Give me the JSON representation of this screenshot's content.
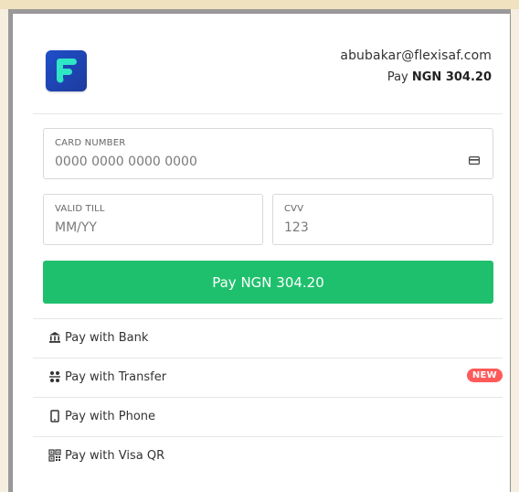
{
  "header": {
    "email": "abubakar@flexisaf.com",
    "pay_prefix": "Pay",
    "pay_amount": "NGN 304.20"
  },
  "card_number": {
    "label": "CARD NUMBER",
    "placeholder": "0000 0000 0000 0000"
  },
  "valid_till": {
    "label": "VALID TILL",
    "placeholder": "MM/YY"
  },
  "cvv": {
    "label": "CVV",
    "placeholder": "123"
  },
  "pay_button": {
    "label": "Pay NGN 304.20"
  },
  "options": [
    {
      "label": "Pay with Bank",
      "icon": "bank-icon"
    },
    {
      "label": "Pay with Transfer",
      "icon": "transfer-icon",
      "badge": "NEW"
    },
    {
      "label": "Pay with Phone",
      "icon": "phone-icon"
    },
    {
      "label": "Pay with Visa QR",
      "icon": "qr-icon"
    }
  ],
  "colors": {
    "accent_green": "#1fc06d",
    "logo_blue": "#1f4fc9",
    "logo_mark": "#2fe6c5",
    "badge_red": "#ff5a5a"
  }
}
